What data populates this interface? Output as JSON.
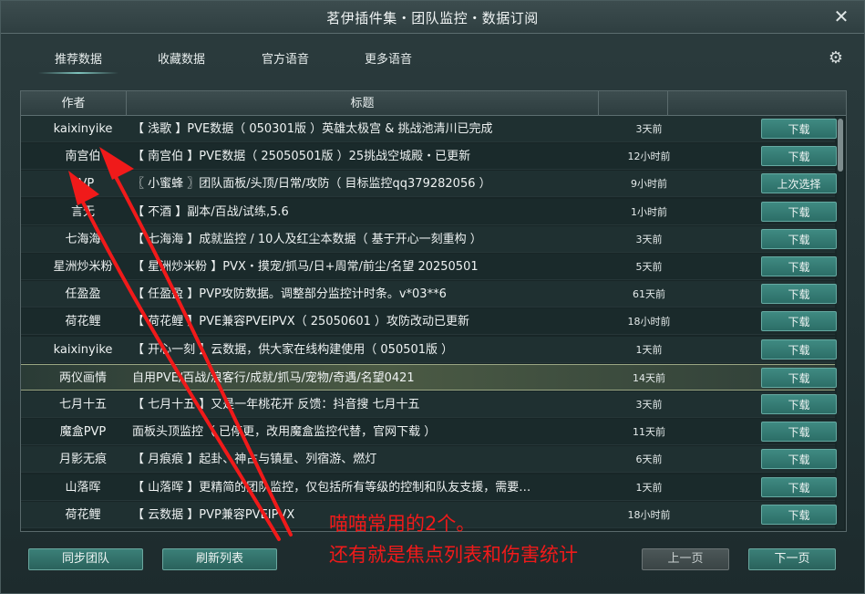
{
  "window": {
    "title": "茗伊插件集・团队监控・数据订阅"
  },
  "tabs": [
    {
      "label": "推荐数据"
    },
    {
      "label": "收藏数据"
    },
    {
      "label": "官方语音"
    },
    {
      "label": "更多语音"
    }
  ],
  "table": {
    "headers": {
      "author": "作者",
      "title": "标题"
    },
    "rows": [
      {
        "author": "kaixinyike",
        "title": "【 浅歌 】PVE数据（ 050301版 ）英雄太极宫 & 挑战池清川已完成",
        "time": "3天前",
        "action": "下载"
      },
      {
        "author": "南宫伯",
        "title": "【 南宫伯 】PVE数据（ 25050501版 ）25挑战空城殿・已更新",
        "time": "12小时前",
        "action": "下载"
      },
      {
        "author": "PVP",
        "title": "〖 小蜜蜂 〗团队面板/头顶/日常/攻防（ 目标监控qq379282056 ）",
        "time": "9小时前",
        "action": "上次选择"
      },
      {
        "author": "言无",
        "title": "【 不酒 】副本/百战/试练,5.6",
        "time": "1小时前",
        "action": "下载"
      },
      {
        "author": "七海海",
        "title": "【 七海海 】成就监控 / 10人及红尘本数据（ 基于开心一刻重构 ）",
        "time": "3天前",
        "action": "下载"
      },
      {
        "author": "星洲炒米粉",
        "title": "【 星洲炒米粉 】PVX・摸宠/抓马/日+周常/前尘/名望 20250501",
        "time": "5天前",
        "action": "下载"
      },
      {
        "author": "任盈盈",
        "title": "【 任盈盈 】PVP攻防数据。调整部分监控计时条。v*03**6",
        "time": "61天前",
        "action": "下载"
      },
      {
        "author": "荷花鲤",
        "title": "【 荷花鲤 】PVE兼容PVEIPVX（ 25050601 ）攻防改动已更新",
        "time": "18小时前",
        "action": "下载"
      },
      {
        "author": "kaixinyike",
        "title": "【 开心一刻 】云数据，供大家在线构建使用（ 050501版 ）",
        "time": "1天前",
        "action": "下载"
      },
      {
        "author": "两仪画情",
        "title": "自用PVE/百战/浪客行/成就/抓马/宠物/奇遇/名望0421",
        "time": "14天前",
        "action": "下载"
      },
      {
        "author": "七月十五",
        "title": "【 七月十五 】又是一年桃花开 反馈：抖音搜 七月十五",
        "time": "3天前",
        "action": "下载"
      },
      {
        "author": "魔盒PVP",
        "title": "面板头顶监控（ 已停更，改用魔盒监控代替，官网下载 ）",
        "time": "11天前",
        "action": "下载"
      },
      {
        "author": "月影无痕",
        "title": "【 月痕痕 】起卦、神占与镇星、列宿游、燃灯",
        "time": "6天前",
        "action": "下载"
      },
      {
        "author": "山落晖",
        "title": "【 山落晖 】更精简的团队监控，仅包括所有等级的控制和队友支援，需要…",
        "time": "1天前",
        "action": "下载"
      },
      {
        "author": "荷花鲤",
        "title": "【 云数据 】PVP兼容PVEIPVX",
        "time": "18小时前",
        "action": "下载"
      }
    ]
  },
  "buttons": {
    "sync_team": "同步团队",
    "refresh": "刷新列表",
    "prev_page": "上一页",
    "next_page": "下一页"
  },
  "annotation": {
    "line1": "喵喵常用的2个。",
    "line2": "还有就是焦点列表和伤害统计",
    "color": "#f01a1a"
  },
  "colors": {
    "accent": "#3f8a82",
    "background": "#223234",
    "highlight_row": "#4b5a44"
  },
  "icons": {
    "close": "close-icon",
    "settings": "gear-icon"
  }
}
